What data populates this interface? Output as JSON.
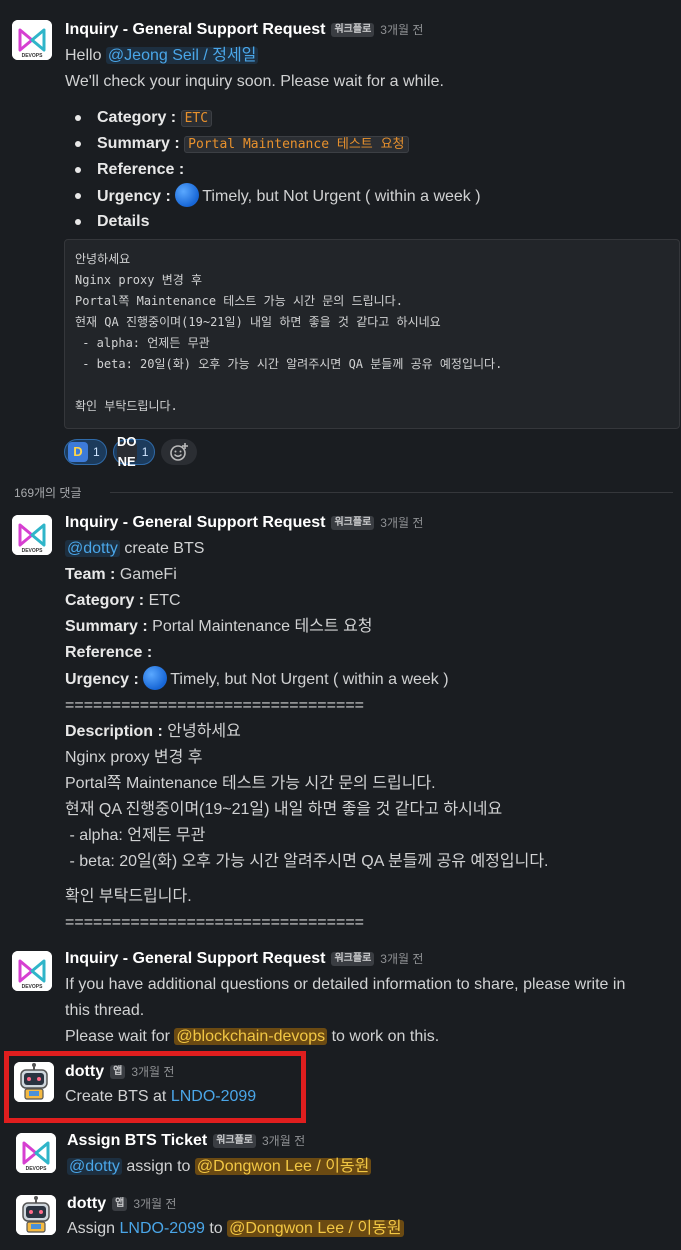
{
  "messages": {
    "m1": {
      "sender": "Inquiry - General Support Request",
      "badge": "워크플로",
      "time": "3개월 전",
      "hello": "Hello",
      "mention": "@Jeong Seil / 정세일",
      "wait": "We'll check your inquiry soon. Please wait for a while.",
      "category_label": "Category :",
      "category_value": "ETC",
      "summary_label": "Summary :",
      "summary_value": "Portal Maintenance 테스트 요청",
      "reference_label": "Reference :",
      "urgency_label": "Urgency :",
      "urgency_value": "Timely, but Not Urgent ( within a week )",
      "details_label": "Details",
      "details_block": "안녕하세요\nNginx proxy 변경 후\nPortal쪽 Maintenance 테스트 가능 시간 문의 드립니다.\n현재 QA 진행중이며(19~21일) 내일 하면 좋을 것 같다고 하시네요\n - alpha: 언제든 무관\n - beta: 20일(화) 오후 가능 시간 알려주시면 QA 분들께 공유 예정입니다.\n\n확인 부탁드립니다.",
      "reactions": [
        {
          "emoji": "D",
          "count": "1"
        },
        {
          "emoji": "DONE",
          "count": "1"
        }
      ]
    },
    "thread_count": "169개의 댓글",
    "m2": {
      "sender": "Inquiry - General Support Request",
      "badge": "워크플로",
      "time": "3개월 전",
      "mention": "@dotty",
      "command": "create BTS",
      "team_label": "Team :",
      "team_value": "GameFi",
      "category_label": "Category :",
      "category_value": "ETC",
      "summary_label": "Summary :",
      "summary_value": "Portal Maintenance 테스트 요청",
      "reference_label": "Reference :",
      "urgency_label": "Urgency :",
      "urgency_value": "Timely, but Not Urgent ( within a week )",
      "separator": "================================",
      "description_label": "Description :",
      "description_lines": [
        "안녕하세요",
        "Nginx proxy 변경 후",
        "Portal쪽 Maintenance 테스트 가능 시간 문의 드립니다.",
        "현재 QA 진행중이며(19~21일) 내일 하면 좋을 것 같다고 하시네요",
        " - alpha: 언제든 무관",
        " - beta: 20일(화) 오후 가능 시간 알려주시면 QA 분들께 공유 예정입니다."
      ],
      "closing": "확인 부탁드립니다.",
      "separator2": "================================"
    },
    "m3": {
      "sender": "Inquiry - General Support Request",
      "badge": "워크플로",
      "time": "3개월 전",
      "line1": "If you have additional questions or detailed information to share, please write in",
      "line2": "this thread.",
      "line3_pre": "Please wait for",
      "mention": "@blockchain-devops",
      "line3_post": "to work on this."
    },
    "m4": {
      "sender": "dotty",
      "badge": "앱",
      "time": "3개월 전",
      "text_pre": "Create BTS at",
      "link": "LNDO-2099"
    },
    "m5": {
      "sender": "Assign BTS Ticket",
      "badge": "워크플로",
      "time": "3개월 전",
      "mention": "@dotty",
      "text": "assign to",
      "mention2": "@Dongwon Lee / 이동원"
    },
    "m6": {
      "sender": "dotty",
      "badge": "앱",
      "time": "3개월 전",
      "text_pre": "Assign",
      "link": "LNDO-2099",
      "text_mid": "to",
      "mention": "@Dongwon Lee / 이동원"
    }
  },
  "avatars": {
    "workflow_logo_text": "DEVOPS",
    "workflow_color": "#2fb5c9",
    "workflow_accent": "#d63fd1"
  }
}
